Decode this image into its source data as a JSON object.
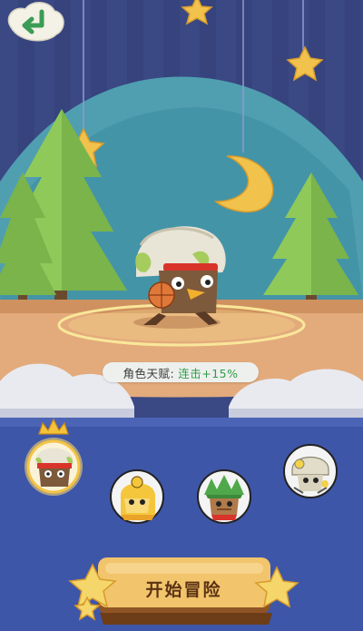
{
  "talent": {
    "label": "角色天赋:",
    "value": "连击+15%"
  },
  "start_button": {
    "label": "开始冒险"
  },
  "back_button": {
    "icon": "back-arrow-icon"
  },
  "character_select": {
    "selected_index": 0,
    "characters": [
      {
        "icon": "white-hair-headband-hero-icon"
      },
      {
        "icon": "yellow-hood-hero-icon"
      },
      {
        "icon": "green-leaf-hero-icon"
      },
      {
        "icon": "white-helmet-hero-icon"
      }
    ]
  },
  "colors": {
    "sky": "#3b4a86",
    "stage": "#e1a777",
    "accent_green": "#2f9e48",
    "button_gold": "#f0c26a"
  }
}
